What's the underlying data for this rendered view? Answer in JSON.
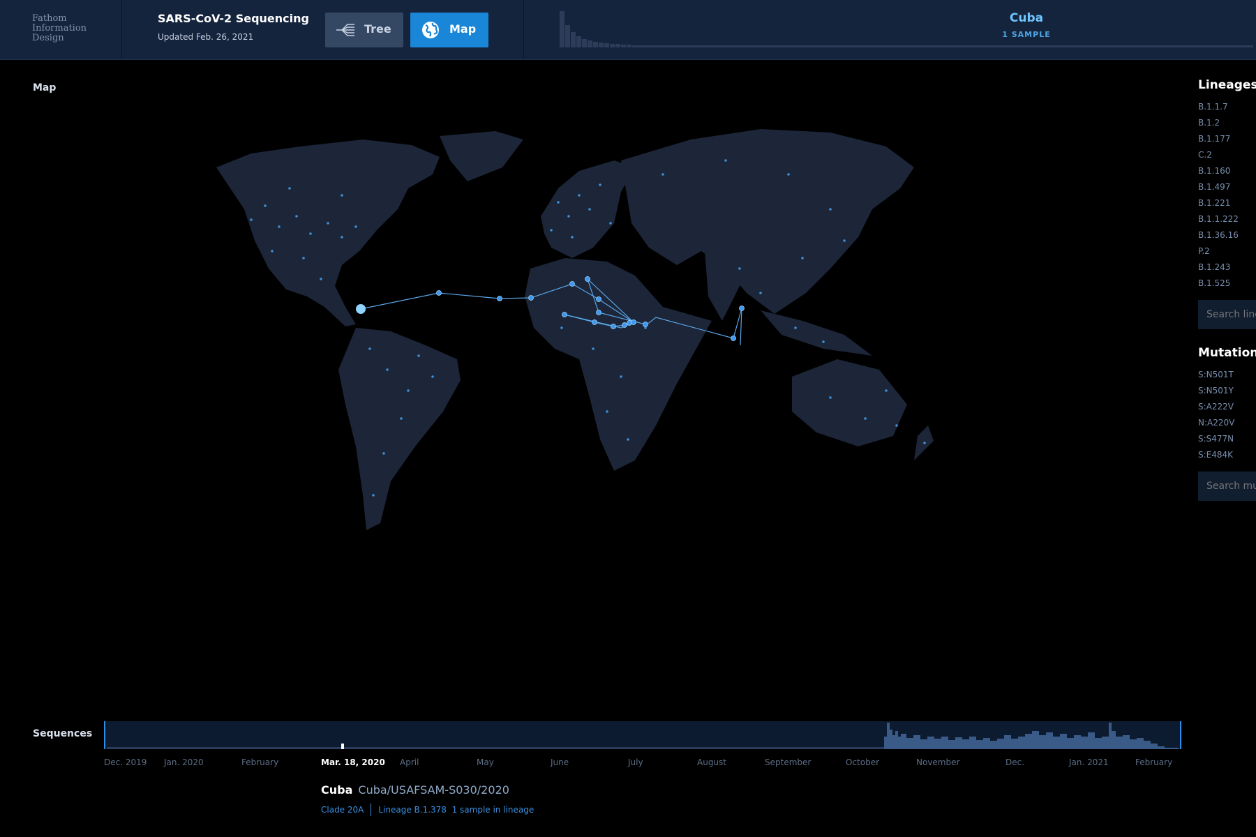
{
  "brand": {
    "line1": "Fathom",
    "line2": "Information",
    "line3": "Design"
  },
  "header": {
    "title": "SARS-CoV-2 Sequencing",
    "updated": "Updated Feb. 26, 2021"
  },
  "views": {
    "tree_label": "Tree",
    "map_label": "Map",
    "active": "Map"
  },
  "selection": {
    "country": "Cuba",
    "samples": "1 SAMPLE"
  },
  "map": {
    "label": "Map"
  },
  "lineages": {
    "heading": "Lineages",
    "items": [
      "B.1.1.7",
      "B.1.2",
      "B.1.177",
      "C.2",
      "B.1.160",
      "B.1.497",
      "B.1.221",
      "B.1.1.222",
      "B.1.36.16",
      "P.2",
      "B.1.243",
      "B.1.525"
    ],
    "search_placeholder": "Search lineages"
  },
  "mutations": {
    "heading": "Mutations",
    "items": [
      "S:N501T",
      "S:N501Y",
      "S:A222V",
      "N:A220V",
      "S:S477N",
      "S:E484K"
    ],
    "search_placeholder": "Search mutations"
  },
  "sequences": {
    "label": "Sequences",
    "timeline": [
      "Dec. 2019",
      "Jan. 2020",
      "February",
      "Mar. 18, 2020",
      "April",
      "May",
      "June",
      "July",
      "August",
      "September",
      "October",
      "November",
      "Dec.",
      "Jan. 2021",
      "February"
    ],
    "selected_date": "Mar. 18, 2020"
  },
  "sample": {
    "country": "Cuba",
    "name": "Cuba/USAFSAM-S030/2020",
    "clade": "Clade 20A",
    "lineage": "Lineage B.1.378",
    "lineage_count": "1 sample in lineage"
  },
  "colors": {
    "accent": "#1a86d8",
    "highlight": "#6fc6ff",
    "topbar": "#15243d",
    "land": "#1c2638",
    "dot": "#3f8ed8"
  }
}
